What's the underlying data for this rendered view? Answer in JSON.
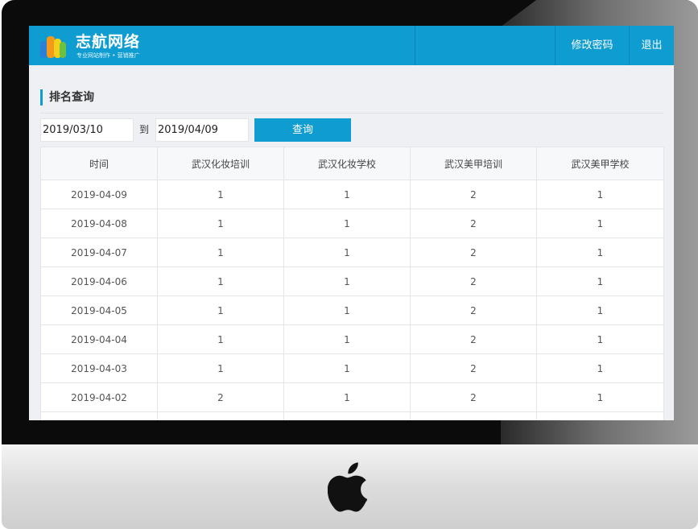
{
  "app": {
    "brand_name": "志航网络",
    "brand_tagline": "专业网站制作 • 营销推广"
  },
  "nav": {
    "change_password": "修改密码",
    "logout": "退出"
  },
  "page": {
    "title": "排名查询"
  },
  "filter": {
    "start_date": "2019/03/10",
    "to_label": "到",
    "end_date": "2019/04/09",
    "query_button": "查询"
  },
  "table": {
    "columns": [
      "时间",
      "武汉化妆培训",
      "武汉化妆学校",
      "武汉美甲培训",
      "武汉美甲学校"
    ],
    "rows": [
      [
        "2019-04-09",
        "1",
        "1",
        "2",
        "1"
      ],
      [
        "2019-04-08",
        "1",
        "1",
        "2",
        "1"
      ],
      [
        "2019-04-07",
        "1",
        "1",
        "2",
        "1"
      ],
      [
        "2019-04-06",
        "1",
        "1",
        "2",
        "1"
      ],
      [
        "2019-04-05",
        "1",
        "1",
        "2",
        "1"
      ],
      [
        "2019-04-04",
        "1",
        "1",
        "2",
        "1"
      ],
      [
        "2019-04-03",
        "1",
        "1",
        "2",
        "1"
      ],
      [
        "2019-04-02",
        "2",
        "1",
        "2",
        "1"
      ],
      [
        "",
        "",
        "",
        "",
        ""
      ]
    ]
  },
  "icons": {
    "logo": "colored-bars-logo-icon",
    "device_logo": "apple-logo-icon"
  },
  "colors": {
    "accent": "#0e9cd1",
    "screen_bg": "#eef0f4"
  }
}
